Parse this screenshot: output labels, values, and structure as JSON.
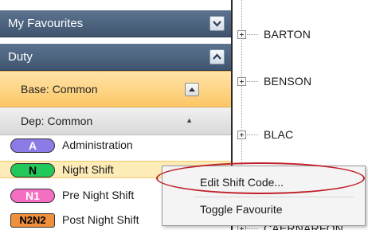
{
  "sidebar": {
    "favourites_header": "My Favourites",
    "duty_header": "Duty",
    "base_label": "Base: Common",
    "dep_label": "Dep: Common",
    "items": [
      {
        "code": "A",
        "label": "Administration",
        "color": "#8a7be6",
        "text_color": "#ffffff"
      },
      {
        "code": "N",
        "label": "Night Shift",
        "color": "#22c95a",
        "text_color": "#000000"
      },
      {
        "code": "N1",
        "label": "Pre Night Shift",
        "color": "#f46ec2",
        "text_color": "#ffffff"
      },
      {
        "code": "N2N2",
        "label": "Post Night Shift",
        "color": "#f08f3c",
        "text_color": "#000000"
      }
    ]
  },
  "tree": {
    "items": [
      {
        "label": "BARTON"
      },
      {
        "label": "BENSON"
      },
      {
        "label": "BLAC"
      },
      {
        "label": "CAERNARFON"
      }
    ]
  },
  "context_menu": {
    "edit_label": "Edit Shift Code...",
    "toggle_label": "Toggle Favourite"
  },
  "colors": {
    "header_bg": "#4a6280",
    "selected_base_bg": "#fcc766",
    "highlight_ring": "#c0202a"
  },
  "icons": {
    "favourites_toggle": "chevron-down-icon",
    "duty_toggle": "chevron-up-icon",
    "base_toggle": "chevron-up-icon",
    "dep_toggle": "caret-up-icon",
    "tree_expander": "plus-box-icon"
  }
}
